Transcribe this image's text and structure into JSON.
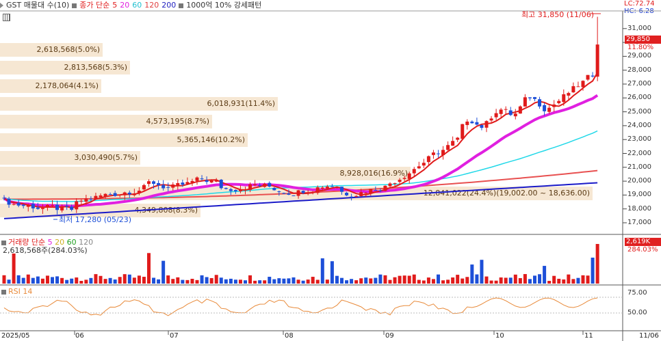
{
  "header": {
    "items": [
      {
        "text": "GST 매물대 수(10)",
        "color": "#333333"
      },
      {
        "text": "종가 단순",
        "color": "#e01b1b"
      },
      {
        "text": "5",
        "color": "#e01b1b"
      },
      {
        "text": "20",
        "color": "#e020e0"
      },
      {
        "text": "60",
        "color": "#20c0d0"
      },
      {
        "text": "120",
        "color": "#e04040"
      },
      {
        "text": "200",
        "color": "#2020c0"
      },
      {
        "text": "1000억 10% 강세패턴",
        "color": "#333333"
      }
    ],
    "lc": "LC:72.74",
    "hc": "HC:-6.28"
  },
  "price_annotations": {
    "high": "최고 31,850 (11/06)",
    "low": "최저 17,280 (05/23)",
    "current_price": "29,850",
    "current_pct": "11.80%"
  },
  "volume_profile": [
    "2,618,568(5.0%)",
    "2,813,568(5.3%)",
    "2,178,064(4.1%)",
    "6,018,931(11.4%)",
    "4,573,195(8.7%)",
    "5,365,146(10.2%)",
    "3,030,490(5.7%)",
    "8,928,016(16.9%)",
    "12,841,022(24.4%)(19,002.00 ~ 18,636.00)",
    "4,349,808(8.3%)"
  ],
  "price_axis": [
    "31,000",
    "30,000",
    "29,000",
    "28,000",
    "27,000",
    "26,000",
    "25,000",
    "24,000",
    "23,000",
    "22,000",
    "21,000",
    "20,000",
    "19,000",
    "18,000",
    "17,000"
  ],
  "volume_panel": {
    "legend": [
      {
        "text": "거래량 단순",
        "color": "#e01b1b"
      },
      {
        "text": "5",
        "color": "#e020e0"
      },
      {
        "text": "20",
        "color": "#d0b020"
      },
      {
        "text": "60",
        "color": "#20a020"
      },
      {
        "text": "120",
        "color": "#888888"
      }
    ],
    "value": "2,618,568주(284.03%)",
    "right_value": "2,619K",
    "right_pct": "284.03%"
  },
  "rsi_panel": {
    "label": "RSI 14",
    "axis": [
      "75.00",
      "50.00"
    ]
  },
  "date_axis": [
    "2025/05",
    "06",
    "07",
    "08",
    "09",
    "10",
    "11",
    "11/06"
  ],
  "colors": {
    "up": "#e01b1b",
    "down": "#1d4fd8",
    "ma5": "#e01b1b",
    "ma20": "#e020e0",
    "ma60": "#20d8e8",
    "ma120": "#e85050",
    "ma200": "#1a1ac8",
    "rsi": "#e88a3a"
  }
}
